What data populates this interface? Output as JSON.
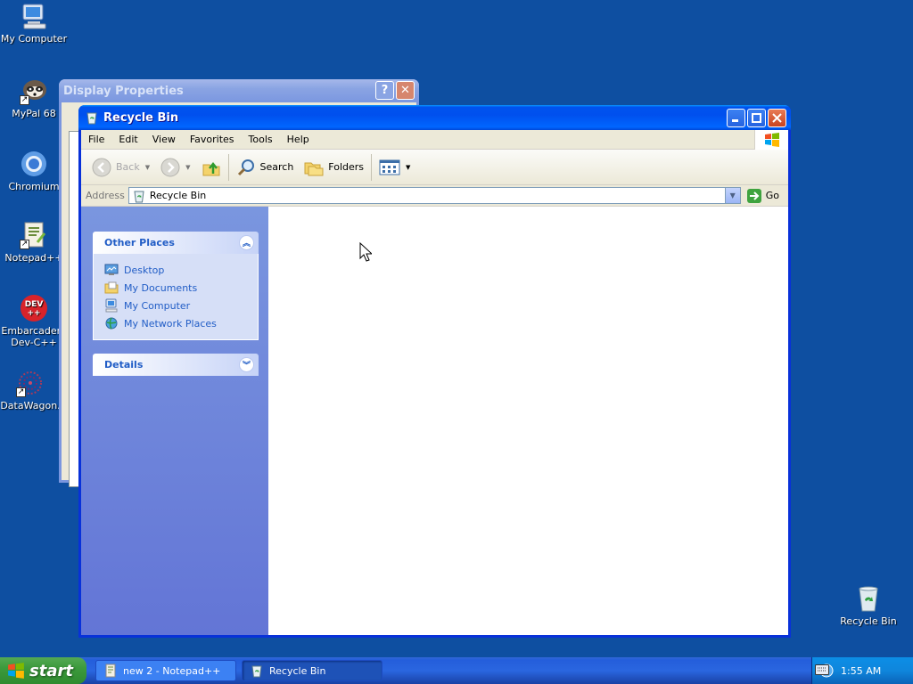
{
  "desktop": {
    "icons": [
      {
        "label": "My Computer"
      },
      {
        "label": "MyPal 68"
      },
      {
        "label": "Chromium"
      },
      {
        "label": "Notepad++"
      },
      {
        "label": "Embarcadero Dev-C++"
      },
      {
        "label": "DataWagon."
      },
      {
        "label": "Recycle Bin"
      }
    ]
  },
  "display_properties": {
    "title": "Display Properties"
  },
  "window": {
    "title": "Recycle Bin",
    "menu": [
      "File",
      "Edit",
      "View",
      "Favorites",
      "Tools",
      "Help"
    ],
    "toolbar": {
      "back": "Back",
      "search": "Search",
      "folders": "Folders"
    },
    "address": {
      "label": "Address",
      "value": "Recycle Bin",
      "go": "Go"
    },
    "taskpane": {
      "other_places": {
        "title": "Other Places",
        "links": [
          "Desktop",
          "My Documents",
          "My Computer",
          "My Network Places"
        ]
      },
      "details": {
        "title": "Details"
      }
    }
  },
  "taskbar": {
    "start": "start",
    "tasks": [
      {
        "label": "new 2 - Notepad++"
      },
      {
        "label": "Recycle Bin"
      }
    ],
    "clock": "1:55 AM"
  }
}
